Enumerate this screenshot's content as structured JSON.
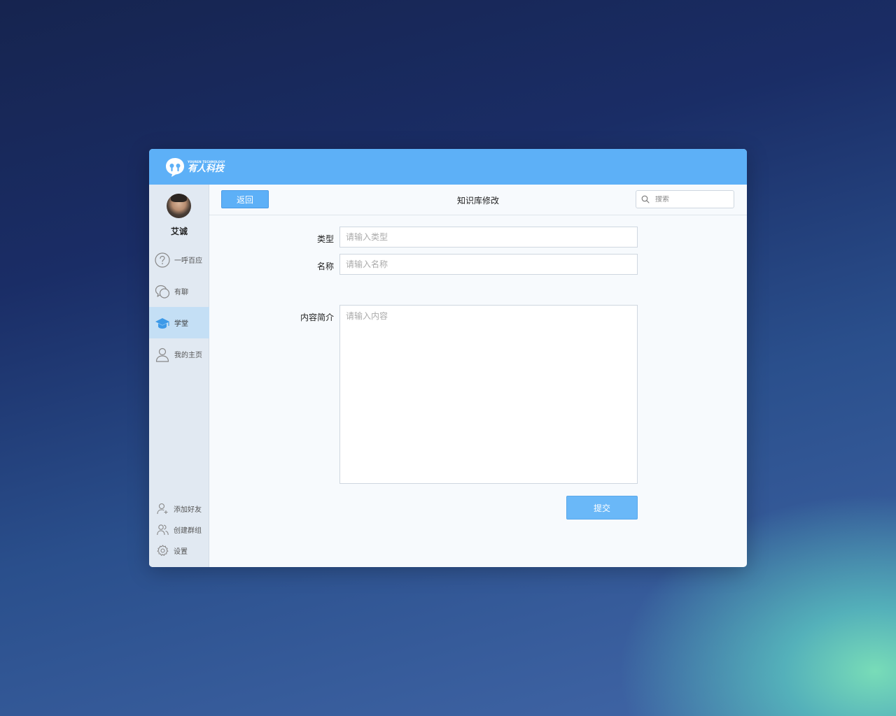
{
  "logo": {
    "english": "YOUREN TECHNOLOGY",
    "chinese": "有人科技"
  },
  "user": {
    "name": "艾诚"
  },
  "sidebar": {
    "items": [
      {
        "label": "一呼百应",
        "icon": "question-circle-icon",
        "active": false
      },
      {
        "label": "有聊",
        "icon": "chat-bubbles-icon",
        "active": false
      },
      {
        "label": "学堂",
        "icon": "graduation-cap-icon",
        "active": true
      },
      {
        "label": "我的主页",
        "icon": "user-icon",
        "active": false
      }
    ],
    "bottom_items": [
      {
        "label": "添加好友",
        "icon": "add-user-icon"
      },
      {
        "label": "创建群组",
        "icon": "create-group-icon"
      },
      {
        "label": "设置",
        "icon": "gear-icon"
      }
    ]
  },
  "toolbar": {
    "back_label": "返回",
    "title": "知识库修改",
    "search_placeholder": "搜索"
  },
  "form": {
    "type_label": "类型",
    "type_placeholder": "请输入类型",
    "name_label": "名称",
    "name_placeholder": "请输入名称",
    "content_label": "内容简介",
    "content_placeholder": "请输入内容",
    "submit_label": "提交"
  },
  "colors": {
    "accent": "#5db0f7",
    "sidebar_bg": "#e1e9f2",
    "active_nav": "#c4dff5"
  }
}
